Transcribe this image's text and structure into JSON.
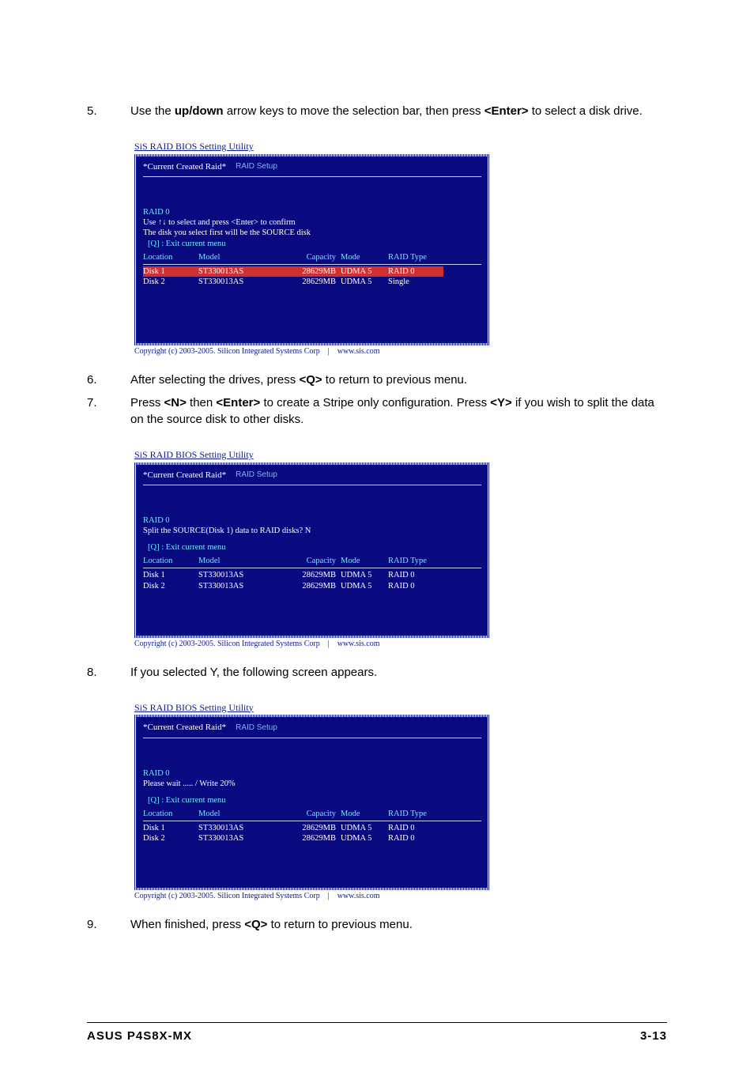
{
  "steps": {
    "s5": {
      "num": "5.",
      "pre": "Use the ",
      "k1": "up/down",
      "mid1": " arrow keys to move the selection bar, then press ",
      "k2": "<Enter>",
      "post": " to select a disk drive."
    },
    "s6": {
      "num": "6.",
      "pre": "After selecting the drives, press ",
      "k1": "<Q>",
      "post": " to return to previous menu."
    },
    "s7": {
      "num": "7.",
      "pre": "Press ",
      "k1": "<N>",
      "mid1": " then ",
      "k2": "<Enter>",
      "mid2": " to create a Stripe only configuration. Press ",
      "k3": "<Y>",
      "post": " if you wish to split the data on the source disk to other disks."
    },
    "s8": {
      "num": "8.",
      "text": "If you selected Y, the following screen appears."
    },
    "s9": {
      "num": "9.",
      "pre": "When finished, press ",
      "k1": "<Q>",
      "post": " to return to previous menu."
    }
  },
  "bios_common": {
    "title": "SiS RAID BIOS Setting Utility",
    "current": "*Current Created Raid*",
    "raid_setup": "RAID Setup",
    "exit": "[Q] : Exit current menu",
    "cols": {
      "loc": "Location",
      "model": "Model",
      "cap": "Capacity",
      "mode": "Mode",
      "type": "RAID Type"
    },
    "footer_left": "Copyright (c) 2003-2005. Silicon Integrated Systems Corp",
    "footer_right": "www.sis.com"
  },
  "bios1": {
    "raid": "RAID 0",
    "line1": "Use ↑↓ to select and press <Enter> to confirm",
    "line2": "The disk you select first will be the SOURCE disk",
    "rows": [
      {
        "loc": "Disk 1",
        "model": "ST330013AS",
        "cap": "28629MB",
        "mode": "UDMA 5",
        "type": "RAID 0",
        "sel": true
      },
      {
        "loc": "Disk 2",
        "model": "ST330013AS",
        "cap": "28629MB",
        "mode": "UDMA 5",
        "type": "Single",
        "sel": false
      }
    ]
  },
  "bios2": {
    "raid": "RAID 0",
    "line1": "Split the SOURCE(Disk 1) data to RAID disks? N",
    "rows": [
      {
        "loc": "Disk 1",
        "model": "ST330013AS",
        "cap": "28629MB",
        "mode": "UDMA 5",
        "type": "RAID 0"
      },
      {
        "loc": "Disk 2",
        "model": "ST330013AS",
        "cap": "28629MB",
        "mode": "UDMA 5",
        "type": "RAID 0"
      }
    ]
  },
  "bios3": {
    "raid": "RAID 0",
    "line1": "Please wait ..... /   Write 20%",
    "rows": [
      {
        "loc": "Disk 1",
        "model": "ST330013AS",
        "cap": "28629MB",
        "mode": "UDMA 5",
        "type": "RAID 0"
      },
      {
        "loc": "Disk 2",
        "model": "ST330013AS",
        "cap": "28629MB",
        "mode": "UDMA 5",
        "type": "RAID 0"
      }
    ]
  },
  "footer": {
    "left": "ASUS P4S8X-MX",
    "right": "3-13"
  }
}
